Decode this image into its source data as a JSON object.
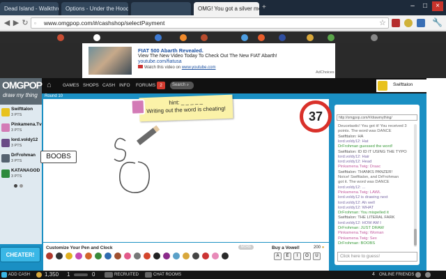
{
  "browser": {
    "tabs": [
      {
        "label": "Dead Island - Walkthrough"
      },
      {
        "label": "Options - Under the Hood"
      },
      {
        "label": ""
      },
      {
        "label": "OMG! You got a silver me..."
      }
    ],
    "url": "www.omgpop.com/#/cashshop/selectPayment"
  },
  "ad": {
    "headline": "FIAT 500 Abarth Revealed.",
    "body": "View The New Video Today To Check Out The New FIAT Abarth!",
    "link": "youtube.com/fiatusa",
    "watch": "Watch this video on",
    "watch_link": "www.youtube.com",
    "choices": "AdChoices"
  },
  "site": {
    "logo": "OMGPOP",
    "tagline": "draw my thing",
    "nav": [
      "GAMES",
      "SHOPS",
      "CASH",
      "INFO",
      "FORUMS"
    ],
    "notifications": "2",
    "search": "Search",
    "user": "Swifttalon",
    "round": "Round 10"
  },
  "players": [
    {
      "name": "Swifttalon",
      "points": "3 PTS",
      "color": "#e8c21e"
    },
    {
      "name": "Pinkamena.Tv",
      "points": "3 PTS",
      "color": "#d37bb6"
    },
    {
      "name": "lord.voldy12",
      "points": "3 PTS",
      "color": "#6a4b87"
    },
    {
      "name": "DrFrohman",
      "points": "3 PTS",
      "color": "#556270"
    },
    {
      "name": "KATANAGOD",
      "points": "3 PTS",
      "color": "#2d8a3c"
    }
  ],
  "game": {
    "hint_label": "hint: _ _ _ _ _",
    "hint_text": "Writing out the word is cheating!",
    "timer": "37",
    "speech": "BOOBS",
    "cheater": "CHEATER!",
    "customize": "Customize Your Pen and Clock",
    "more": "MORE",
    "buy_vowel": "Buy a Vowel!",
    "vowel_cost": "200",
    "vowels": [
      "A",
      "E",
      "I",
      "O",
      "U"
    ]
  },
  "chat": {
    "header": "http://omgpop.com/#/drawmything/",
    "messages": [
      {
        "text": "Deucetastic! You got it! You received 3",
        "color": "#666666"
      },
      {
        "text": "points. The word was DANCE",
        "color": "#666666"
      },
      {
        "text": "Swifttalon: HA",
        "color": "#555"
      },
      {
        "text": "lord.voldy12: Hat",
        "color": "#7a6aa5"
      },
      {
        "text": "DrFrohman guessed the word!",
        "color": "#3a9a3a"
      },
      {
        "text": "Swifttalon: ID ID IT USING THE TYPO",
        "color": "#555"
      },
      {
        "text": "lord.voldy12: Hair",
        "color": "#7a6aa5"
      },
      {
        "text": "lord.voldy12: Head",
        "color": "#7a6aa5"
      },
      {
        "text": "Pinkamena.Twig: Draac",
        "color": "#c25a9e"
      },
      {
        "text": "Swifttalon: THANKS PANZER!",
        "color": "#555"
      },
      {
        "text": "Noice! Swifttalon, and DrFrohman",
        "color": "#666666"
      },
      {
        "text": "got it. The word was DANCE",
        "color": "#666666"
      },
      {
        "text": "lord.voldy12: ...",
        "color": "#7a6aa5"
      },
      {
        "text": "Pinkamena.Twig: LAWL",
        "color": "#c25a9e"
      },
      {
        "text": "lord.voldy12 is drawing next",
        "color": "#7a6aa5"
      },
      {
        "text": "lord.voldy12: Ah well",
        "color": "#7a6aa5"
      },
      {
        "text": "lord.voldy12: WHAT",
        "color": "#7a6aa5"
      },
      {
        "text": "DrFrohman: You mispelled it",
        "color": "#3a9a3a"
      },
      {
        "text": "Swifttalon: THE LITERAL FARK",
        "color": "#555"
      },
      {
        "text": "lord.voldy12: HOW AM I",
        "color": "#7a6aa5"
      },
      {
        "text": "DrFrohman: JUST DRAW",
        "color": "#3a9a3a"
      },
      {
        "text": "Pinkamena.Twig: Woman",
        "color": "#c25a9e"
      },
      {
        "text": "Pinkamena.Twig: Sex",
        "color": "#c25a9e"
      },
      {
        "text": "DrFrohman: BOOBS",
        "color": "#3a9a3a"
      }
    ],
    "input_placeholder": "Click here to guess!"
  },
  "bottom": {
    "add_cash": "ADD CASH",
    "coins": "1,350",
    "items": "1",
    "zero": "0",
    "recruited": "RECRUITED",
    "chat_rooms": "CHAT ROOMS",
    "online_count": "4",
    "online": "ONLINE FRIENDS"
  },
  "colors": {
    "game_blue": "#1a8fc3",
    "timer_red": "#d9312a",
    "hint_yellow": "#fbf2a8",
    "cheater_blue": "#3ab7e6"
  }
}
